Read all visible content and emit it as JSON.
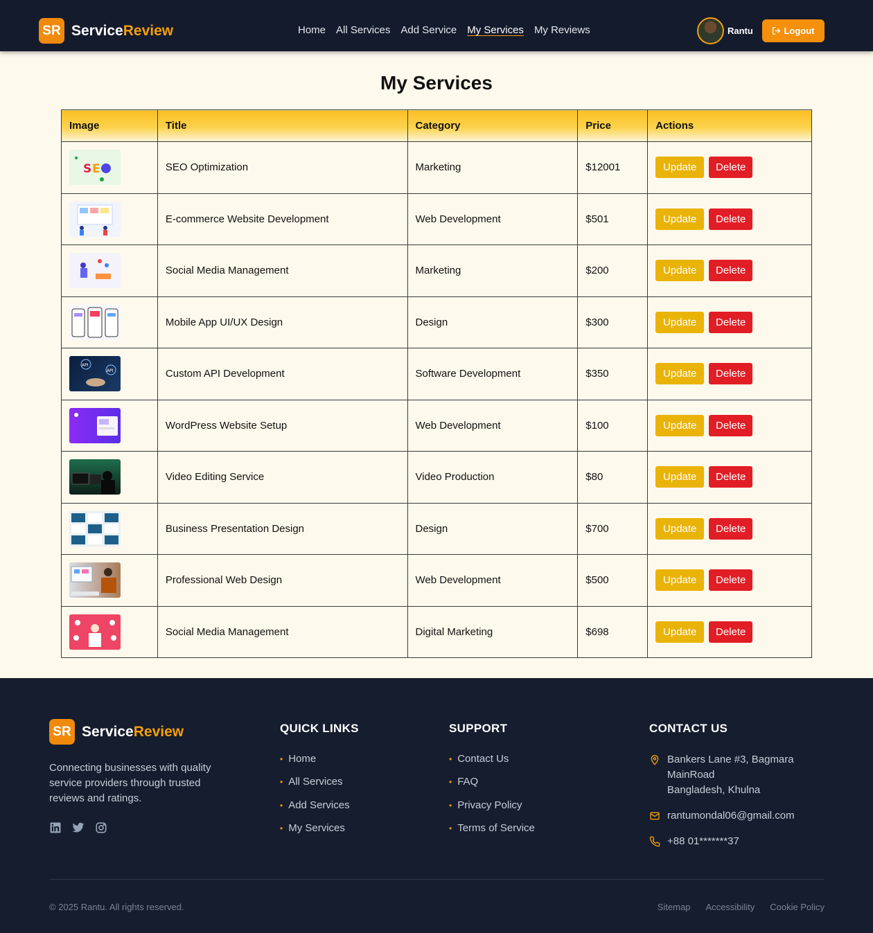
{
  "brand": {
    "badge": "SR",
    "name_part1": "Service",
    "name_part2": "Review"
  },
  "nav": {
    "items": [
      {
        "label": "Home"
      },
      {
        "label": "All Services"
      },
      {
        "label": "Add Service"
      },
      {
        "label": "My Services",
        "active": true
      },
      {
        "label": "My Reviews"
      }
    ]
  },
  "user": {
    "name": "Rantu",
    "logout_label": "Logout"
  },
  "page": {
    "title": "My Services"
  },
  "table": {
    "headers": [
      "Image",
      "Title",
      "Category",
      "Price",
      "Actions"
    ],
    "update_label": "Update",
    "delete_label": "Delete",
    "rows": [
      {
        "title": "SEO Optimization",
        "category": "Marketing",
        "price": "$12001",
        "thumb": "seo"
      },
      {
        "title": "E-commerce Website Development",
        "category": "Web Development",
        "price": "$501",
        "thumb": "ecommerce"
      },
      {
        "title": "Social Media Management",
        "category": "Marketing",
        "price": "$200",
        "thumb": "social"
      },
      {
        "title": "Mobile App UI/UX Design",
        "category": "Design",
        "price": "$300",
        "thumb": "mobile"
      },
      {
        "title": "Custom API Development",
        "category": "Software Development",
        "price": "$350",
        "thumb": "api"
      },
      {
        "title": "WordPress Website Setup",
        "category": "Web Development",
        "price": "$100",
        "thumb": "wordpress"
      },
      {
        "title": "Video Editing Service",
        "category": "Video Production",
        "price": "$80",
        "thumb": "video"
      },
      {
        "title": "Business Presentation Design",
        "category": "Design",
        "price": "$700",
        "thumb": "presentation"
      },
      {
        "title": "Professional Web Design",
        "category": "Web Development",
        "price": "$500",
        "thumb": "webdesign"
      },
      {
        "title": "Social Media Management",
        "category": "Digital Marketing",
        "price": "$698",
        "thumb": "digital"
      }
    ]
  },
  "footer": {
    "description": "Connecting businesses with quality service providers through trusted reviews and ratings.",
    "social_icons": [
      "linkedin-icon",
      "twitter-icon",
      "instagram-icon"
    ],
    "quick_links": {
      "title": "QUICK LINKS",
      "items": [
        "Home",
        "All Services",
        "Add Services",
        "My Services"
      ]
    },
    "support": {
      "title": "SUPPORT",
      "items": [
        "Contact Us",
        "FAQ",
        "Privacy Policy",
        "Terms of Service"
      ]
    },
    "contact": {
      "title": "CONTACT US",
      "address_line1": "Bankers Lane #3, Bagmara",
      "address_line2": "MainRoad",
      "address_line3": "Bangladesh, Khulna",
      "email": "rantumondal06@gmail.com",
      "phone": "+88 01*******37"
    },
    "copyright": "© 2025 Rantu. All rights reserved.",
    "bottom_links": [
      "Sitemap",
      "Accessibility",
      "Cookie Policy"
    ]
  },
  "colors": {
    "header_bg": "#141b2d",
    "accent": "#f59e0b",
    "update": "#eab308",
    "delete": "#e11d25",
    "page_bg": "#fdf9ec"
  }
}
